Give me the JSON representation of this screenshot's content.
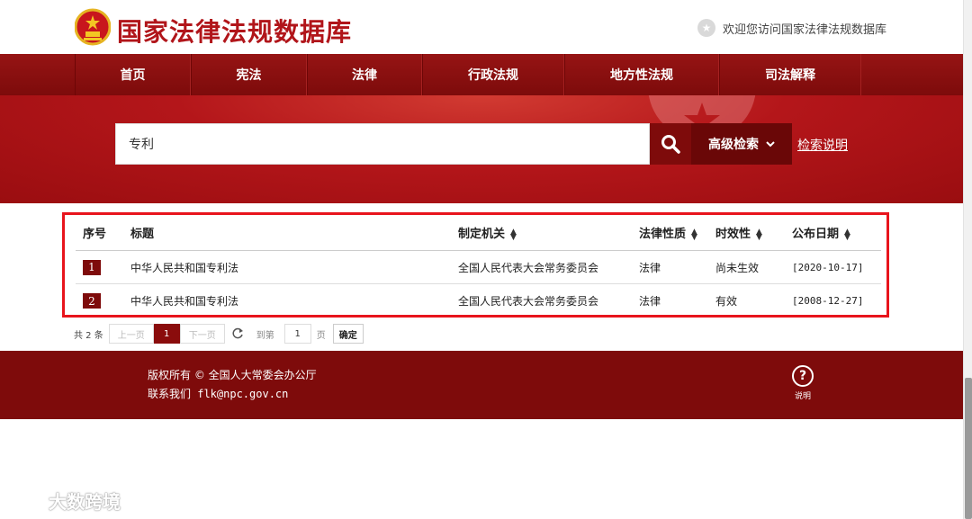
{
  "header": {
    "site_title": "国家法律法规数据库",
    "welcome": "欢迎您访问国家法律法规数据库"
  },
  "nav": {
    "items": [
      "首页",
      "宪法",
      "法律",
      "行政法规",
      "地方性法规",
      "司法解释"
    ]
  },
  "search": {
    "query": "专利",
    "advanced_label": "高级检索",
    "help_link": "检索说明"
  },
  "table": {
    "headers": {
      "index": "序号",
      "title": "标题",
      "authority": "制定机关",
      "nature": "法律性质",
      "status": "时效性",
      "date": "公布日期"
    },
    "rows": [
      {
        "index": "1",
        "title": "中华人民共和国专利法",
        "authority": "全国人民代表大会常务委员会",
        "nature": "法律",
        "status": "尚未生效",
        "date": "[2020-10-17]"
      },
      {
        "index": "2",
        "title": "中华人民共和国专利法",
        "authority": "全国人民代表大会常务委员会",
        "nature": "法律",
        "status": "有效",
        "date": "[2008-12-27]"
      }
    ]
  },
  "pager": {
    "total": "共 2 条",
    "prev": "上一页",
    "current": "1",
    "next": "下一页",
    "goto": "到第",
    "page_value": "1",
    "page_unit": "页",
    "confirm": "确定"
  },
  "footer": {
    "copyright": "版权所有 © 全国人大常委会办公厅",
    "contact": "联系我们 flk@npc.gov.cn",
    "help_label": "说明"
  },
  "watermark": "大数跨境",
  "colors": {
    "brand_red": "#b1151a",
    "nav_red": "#8c1010",
    "footer_red": "#7e0b0b",
    "highlight_border": "#e8141c"
  }
}
